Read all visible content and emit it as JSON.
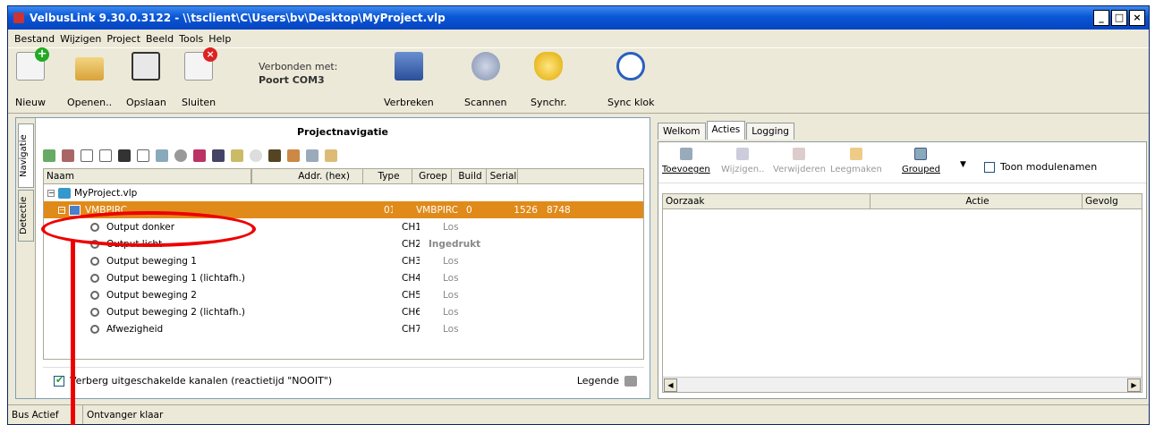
{
  "window": {
    "title": "VelbusLink 9.30.0.3122 - \\\\tsclient\\C\\Users\\bv\\Desktop\\MyProject.vlp",
    "minimize": "_",
    "maximize": "□",
    "close": "×"
  },
  "menu": [
    "Bestand",
    "Wijzigen",
    "Project",
    "Beeld",
    "Tools",
    "Help"
  ],
  "toolbar": {
    "new": "Nieuw",
    "open": "Openen..",
    "save": "Opslaan",
    "close": "Sluiten",
    "connected_label": "Verbonden met:",
    "port": "Poort COM3",
    "disconnect": "Verbreken",
    "scan": "Scannen",
    "sync": "Synchr.",
    "sync_clock": "Sync klok"
  },
  "left": {
    "title": "Projectnavigatie",
    "vtab_nav": "Navigatie",
    "vtab_detect": "Detectie",
    "columns": {
      "name": "Naam",
      "addr": "Addr. (hex)",
      "type": "Type",
      "group": "Groep",
      "build": "Build",
      "serial": "Serial"
    },
    "project": "MyProject.vlp",
    "module": {
      "name": "VMBPIRC",
      "addr": "01",
      "type": "VMBPIRC",
      "group": "0",
      "build": "1526",
      "serial": "8748"
    },
    "channels": [
      {
        "name": "Output donker",
        "ch": "CH1",
        "state": "Los"
      },
      {
        "name": "Output licht",
        "ch": "CH2",
        "state": "Ingedrukt"
      },
      {
        "name": "Output beweging 1",
        "ch": "CH3",
        "state": "Los"
      },
      {
        "name": "Output beweging 1 (lichtafh.)",
        "ch": "CH4",
        "state": "Los"
      },
      {
        "name": "Output beweging 2",
        "ch": "CH5",
        "state": "Los"
      },
      {
        "name": "Output beweging 2 (lichtafh.)",
        "ch": "CH6",
        "state": "Los"
      },
      {
        "name": "Afwezigheid",
        "ch": "CH7",
        "state": "Los"
      }
    ],
    "hide_disabled": "Verberg uitgeschakelde kanalen (reactietijd \"NOOIT\")",
    "legend": "Legende"
  },
  "right": {
    "tabs": [
      "Welkom",
      "Acties",
      "Logging"
    ],
    "add": "Toevoegen",
    "edit": "Wijzigen..",
    "remove": "Verwijderen",
    "clear": "Leegmaken",
    "grouped": "Grouped",
    "show_names": "Toon modulenamen",
    "col_cause": "Oorzaak",
    "col_action": "Actie",
    "col_effect": "Gevolg"
  },
  "status": {
    "bus": "Bus Actief",
    "receiver": "Ontvanger klaar"
  },
  "colors": {
    "selected_row": "#e08a1a",
    "annotation": "#e00000",
    "titlebar": "#0a56d6"
  }
}
